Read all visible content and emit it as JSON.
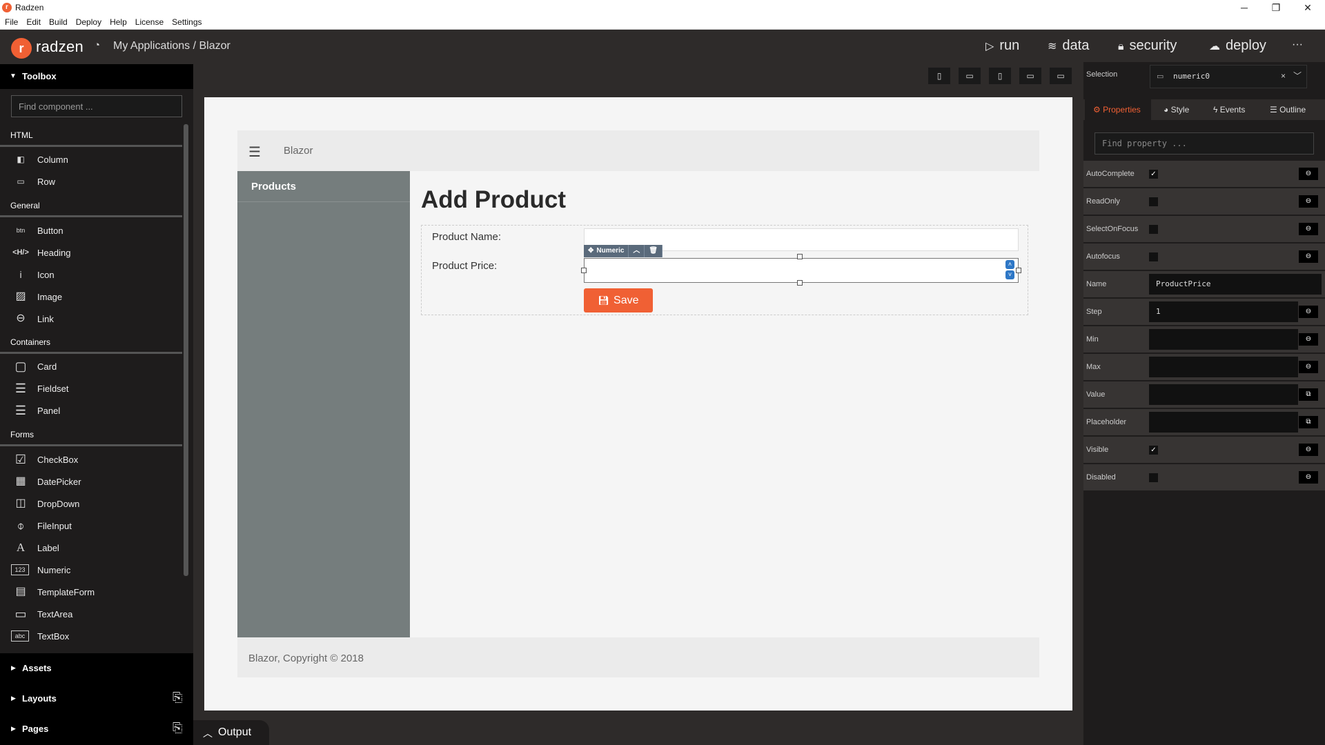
{
  "window": {
    "title": "Radzen",
    "controls": [
      "─",
      "❐",
      "✕"
    ]
  },
  "menu": [
    "File",
    "Edit",
    "Build",
    "Deploy",
    "Help",
    "License",
    "Settings"
  ],
  "header": {
    "brand": "radzen",
    "breadcrumb": "My Applications / Blazor",
    "nav": {
      "run": "run",
      "data": "data",
      "security": "security",
      "deploy": "deploy",
      "more": "···"
    }
  },
  "toolbox": {
    "title": "Toolbox",
    "search_placeholder": "Find component ...",
    "sections": {
      "html": {
        "title": "HTML",
        "items": [
          "Column",
          "Row"
        ]
      },
      "general": {
        "title": "General",
        "items": [
          "Button",
          "Heading",
          "Icon",
          "Image",
          "Link"
        ]
      },
      "containers": {
        "title": "Containers",
        "items": [
          "Card",
          "Fieldset",
          "Panel"
        ]
      },
      "forms": {
        "title": "Forms",
        "items": [
          "CheckBox",
          "DatePicker",
          "DropDown",
          "FileInput",
          "Label",
          "Numeric",
          "TemplateForm",
          "TextArea",
          "TextBox"
        ]
      }
    },
    "icon_text": {
      "button": "btn",
      "heading": "<H/>",
      "icon": "i",
      "label": "A",
      "numeric": "123",
      "textbox": "abc"
    },
    "bottom": {
      "assets": "Assets",
      "layouts": "Layouts",
      "pages": "Pages"
    }
  },
  "output": {
    "label": "Output"
  },
  "design": {
    "app_brand": "Blazor",
    "sidebar_item": "Products",
    "title": "Add Product",
    "form": {
      "name_label": "Product Name:",
      "price_label": "Product Price:",
      "selected_component": "Numeric",
      "save_label": "Save"
    },
    "footer": "Blazor, Copyright © 2018"
  },
  "properties": {
    "selection_label": "Selection",
    "selection_value": "numeric0",
    "tabs": {
      "properties": "Properties",
      "style": "Style",
      "events": "Events",
      "outline": "Outline"
    },
    "search_placeholder": "Find property ...",
    "rows": {
      "autocomplete": {
        "label": "AutoComplete",
        "checked": true
      },
      "readonly": {
        "label": "ReadOnly",
        "checked": false
      },
      "selectonfocus": {
        "label": "SelectOnFocus",
        "checked": false
      },
      "autofocus": {
        "label": "Autofocus",
        "checked": false
      },
      "name": {
        "label": "Name",
        "value": "ProductPrice"
      },
      "step": {
        "label": "Step",
        "value": "1"
      },
      "min": {
        "label": "Min",
        "value": ""
      },
      "max": {
        "label": "Max",
        "value": ""
      },
      "value": {
        "label": "Value",
        "value": ""
      },
      "placeholder": {
        "label": "Placeholder",
        "value": ""
      },
      "visible": {
        "label": "Visible",
        "checked": true
      },
      "disabled": {
        "label": "Disabled",
        "checked": false
      }
    }
  },
  "colors": {
    "accent": "#f06034",
    "toolbar_dark": "#2e2b2a",
    "sidebar": "#757d7d"
  }
}
